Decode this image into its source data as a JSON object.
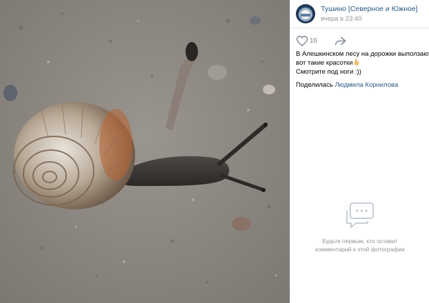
{
  "post": {
    "group_name": "Тушино [Северное и Южное]",
    "time": "вчера в 23:40",
    "likes": "16",
    "text_lines": [
      "В Алешкинском лесу на дорожки выползают",
      "вот такие красотки",
      "Смотрите под ноги :))"
    ],
    "shared_prefix": "Поделилась",
    "shared_author": "Людмила Корнилова"
  },
  "comments": {
    "empty_lines": [
      "Будьте первым, кто оставит",
      "комментарий к этой фотографии"
    ]
  },
  "icons": {
    "like": "heart-icon",
    "share": "share-arrow-icon",
    "comments_empty": "speech-bubble-icon",
    "avatar": "group-avatar",
    "emoji": "pointing-finger-emoji"
  },
  "colors": {
    "link": "#2a5885",
    "muted": "#939393",
    "divider": "#e7e8ec"
  }
}
